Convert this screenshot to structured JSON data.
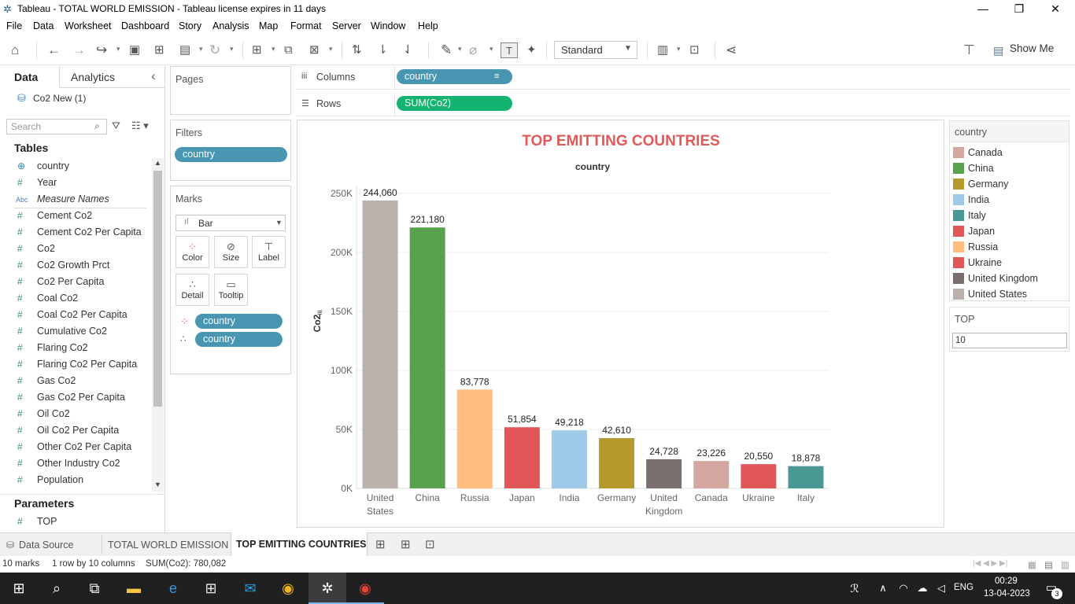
{
  "window": {
    "title": "Tableau - TOTAL WORLD EMISSION - Tableau license expires in 11 days",
    "minimize": "—",
    "restore": "❐",
    "close": "✕"
  },
  "menu": [
    "File",
    "Data",
    "Worksheet",
    "Dashboard",
    "Story",
    "Analysis",
    "Map",
    "Format",
    "Server",
    "Window",
    "Help"
  ],
  "toolbar": {
    "view_mode": "Standard",
    "show_me": "Show Me"
  },
  "data_pane": {
    "tabs": [
      "Data",
      "Analytics"
    ],
    "collapse_icon": "‹",
    "datasource": "Co2 New (1)",
    "search_placeholder": "Search",
    "tables_header": "Tables",
    "fields": [
      {
        "icon": "globe",
        "glyph": "⊕",
        "name": "country"
      },
      {
        "icon": "measure",
        "glyph": "#",
        "name": "Year"
      },
      {
        "icon": "abc",
        "glyph": "Abc",
        "name": "Measure Names"
      },
      {
        "icon": "measure",
        "glyph": "#",
        "name": "Cement Co2"
      },
      {
        "icon": "measure",
        "glyph": "#",
        "name": "Cement Co2 Per Capita"
      },
      {
        "icon": "measure",
        "glyph": "#",
        "name": "Co2"
      },
      {
        "icon": "measure",
        "glyph": "#",
        "name": "Co2 Growth Prct"
      },
      {
        "icon": "measure",
        "glyph": "#",
        "name": "Co2 Per Capita"
      },
      {
        "icon": "measure",
        "glyph": "#",
        "name": "Coal Co2"
      },
      {
        "icon": "measure",
        "glyph": "#",
        "name": "Coal Co2 Per Capita"
      },
      {
        "icon": "measure",
        "glyph": "#",
        "name": "Cumulative Co2"
      },
      {
        "icon": "measure",
        "glyph": "#",
        "name": "Flaring Co2"
      },
      {
        "icon": "measure",
        "glyph": "#",
        "name": "Flaring Co2 Per Capita"
      },
      {
        "icon": "measure",
        "glyph": "#",
        "name": "Gas Co2"
      },
      {
        "icon": "measure",
        "glyph": "#",
        "name": "Gas Co2 Per Capita"
      },
      {
        "icon": "measure",
        "glyph": "#",
        "name": "Oil Co2"
      },
      {
        "icon": "measure",
        "glyph": "#",
        "name": "Oil Co2 Per Capita"
      },
      {
        "icon": "measure",
        "glyph": "#",
        "name": "Other Co2 Per Capita"
      },
      {
        "icon": "measure",
        "glyph": "#",
        "name": "Other Industry Co2"
      },
      {
        "icon": "measure",
        "glyph": "#",
        "name": "Population"
      }
    ],
    "parameters_header": "Parameters",
    "parameters": [
      {
        "glyph": "#",
        "name": "TOP"
      }
    ]
  },
  "shelves": {
    "pages": "Pages",
    "filters": "Filters",
    "filter_pill": "country",
    "marks": "Marks",
    "mark_type": "Bar",
    "mark_buttons": [
      "Color",
      "Size",
      "Label",
      "Detail",
      "Tooltip"
    ],
    "mark_pills": [
      "country",
      "country"
    ],
    "columns_label": "Columns",
    "columns_pill": "country",
    "rows_label": "Rows",
    "rows_pill": "SUM(Co2)"
  },
  "chart_data": {
    "type": "bar",
    "title": "TOP EMITTING COUNTRIES",
    "header": "country",
    "ylabel": "Co2",
    "ylim": [
      0,
      250000
    ],
    "yticks": [
      "0K",
      "50K",
      "100K",
      "150K",
      "200K",
      "250K"
    ],
    "categories": [
      "United States",
      "China",
      "Russia",
      "Japan",
      "India",
      "Germany",
      "United Kingdom",
      "Canada",
      "Ukraine",
      "Italy"
    ],
    "category_lines": [
      [
        "United",
        "States"
      ],
      [
        "China"
      ],
      [
        "Russia"
      ],
      [
        "Japan"
      ],
      [
        "India"
      ],
      [
        "Germany"
      ],
      [
        "United",
        "Kingdom"
      ],
      [
        "Canada"
      ],
      [
        "Ukraine"
      ],
      [
        "Italy"
      ]
    ],
    "values": [
      244060,
      221180,
      83778,
      51854,
      49218,
      42610,
      24728,
      23226,
      20550,
      18878
    ],
    "labels": [
      "244,060",
      "221,180",
      "83,778",
      "51,854",
      "49,218",
      "42,610",
      "24,728",
      "23,226",
      "20,550",
      "18,878"
    ],
    "colors": [
      "#bab0ac",
      "#59a14f",
      "#ffbe7d",
      "#e15759",
      "#a0cbe8",
      "#b6992d",
      "#79706e",
      "#d4a6a0",
      "#e15759",
      "#499894"
    ],
    "grid": true
  },
  "legend": {
    "title": "country",
    "items": [
      {
        "label": "Canada",
        "color": "#d4a6a0"
      },
      {
        "label": "China",
        "color": "#59a14f"
      },
      {
        "label": "Germany",
        "color": "#b6992d"
      },
      {
        "label": "India",
        "color": "#a0cbe8"
      },
      {
        "label": "Italy",
        "color": "#499894"
      },
      {
        "label": "Japan",
        "color": "#e15759"
      },
      {
        "label": "Russia",
        "color": "#ffbe7d"
      },
      {
        "label": "Ukraine",
        "color": "#e15759"
      },
      {
        "label": "United Kingdom",
        "color": "#79706e"
      },
      {
        "label": "United States",
        "color": "#bab0ac"
      }
    ]
  },
  "top_param": {
    "title": "TOP",
    "value": "10"
  },
  "sheet_tabs": {
    "data_source": "Data Source",
    "tabs": [
      "TOTAL WORLD EMISSION",
      "TOP EMITTING COUNTRIES"
    ],
    "active": "TOP EMITTING COUNTRIES"
  },
  "status": {
    "marks": "10 marks",
    "rows": "1 row by 10 columns",
    "sum": "SUM(Co2): 780,082"
  },
  "taskbar": {
    "lang": "ENG",
    "time": "00:29",
    "date": "13-04-2023",
    "notif_count": "3"
  }
}
